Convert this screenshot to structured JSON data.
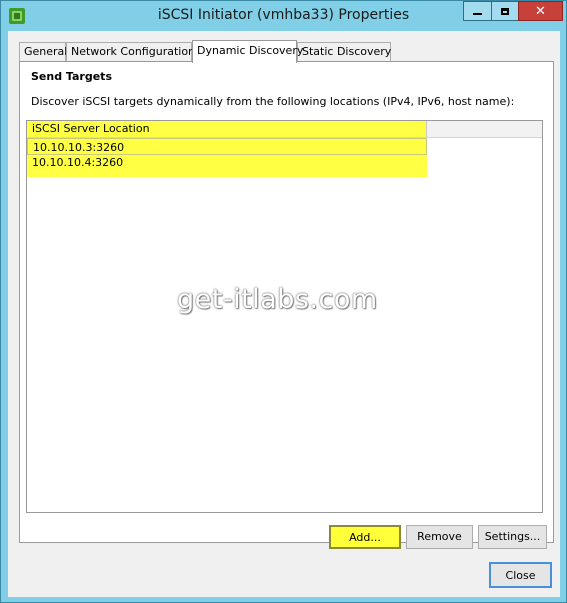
{
  "window": {
    "title": "iSCSI Initiator (vmhba33) Properties",
    "controls": {
      "minimize": "minimize",
      "maximize": "maximize",
      "close": "✕"
    }
  },
  "tabs": [
    {
      "label": "General",
      "active": false
    },
    {
      "label": "Network Configuration",
      "active": false
    },
    {
      "label": "Dynamic Discovery",
      "active": true
    },
    {
      "label": "Static Discovery",
      "active": false
    }
  ],
  "panel": {
    "section_title": "Send Targets",
    "description": "Discover iSCSI targets dynamically from the following locations (IPv4, IPv6, host name):",
    "list": {
      "column_header": "iSCSI Server Location",
      "rows": [
        "10.10.10.3:3260",
        "10.10.10.4:3260"
      ]
    },
    "buttons": {
      "add": "Add...",
      "remove": "Remove",
      "settings": "Settings..."
    }
  },
  "footer": {
    "close": "Close"
  },
  "watermark": "get-itlabs.com",
  "colors": {
    "titlebar": "#80cfe6",
    "highlight": "#ffff44",
    "close_button": "#c7403a"
  },
  "icons": {
    "app": "vsphere-logo-icon"
  }
}
